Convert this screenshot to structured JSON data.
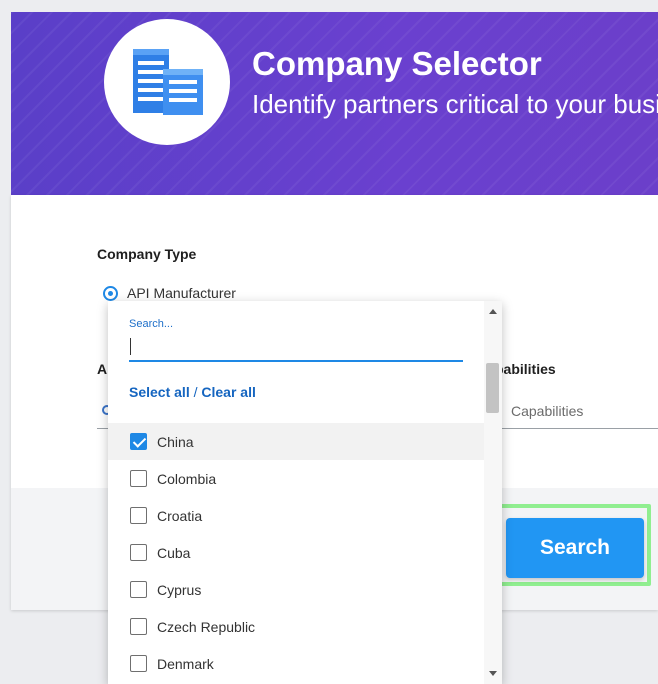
{
  "header": {
    "title": "Company Selector",
    "subtitle": "Identify partners critical to your busi",
    "logo_icon": "buildings-icon"
  },
  "form": {
    "company_type_label": "Company Type",
    "company_type_option": "API Manufacturer",
    "clipped_left_label": "A",
    "capabilities_label": "pabilities",
    "capabilities_placeholder": "Capabilities"
  },
  "search_button": {
    "label": "Search",
    "highlight_color": "#90ee90"
  },
  "dropdown": {
    "search_label": "Search...",
    "search_value": "",
    "select_all": "Select all",
    "separator": "/",
    "clear_all": "Clear all",
    "items": [
      {
        "label": "China",
        "checked": true
      },
      {
        "label": "Colombia",
        "checked": false
      },
      {
        "label": "Croatia",
        "checked": false
      },
      {
        "label": "Cuba",
        "checked": false
      },
      {
        "label": "Cyprus",
        "checked": false
      },
      {
        "label": "Czech Republic",
        "checked": false
      },
      {
        "label": "Denmark",
        "checked": false
      }
    ]
  },
  "colors": {
    "banner": "#5b3cc4",
    "accent": "#1e88e5",
    "button": "#2196f3"
  }
}
